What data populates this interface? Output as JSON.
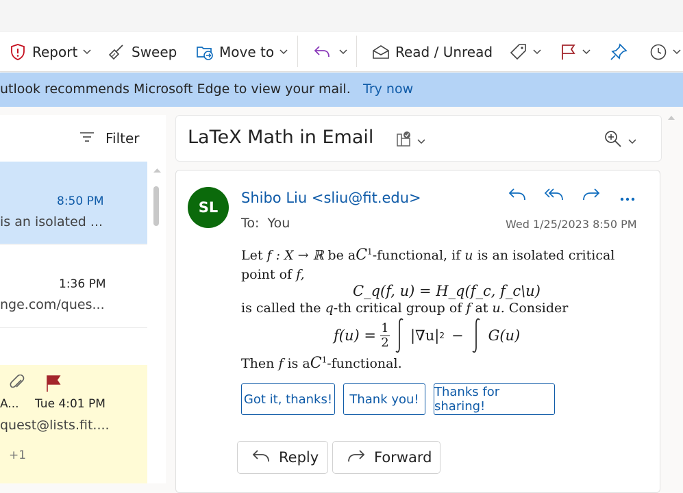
{
  "toolbar": {
    "report_label": "Report",
    "sweep_label": "Sweep",
    "move_label": "Move to",
    "read_label": "Read / Unread"
  },
  "banner": {
    "text": "utlook recommends Microsoft Edge to view your mail.",
    "link": "Try now"
  },
  "list": {
    "filter_label": "Filter",
    "items": [
      {
        "time": "8:50 PM",
        "preview": "is an isolated ..."
      },
      {
        "time": "1:36 PM",
        "preview": "nge.com/ques..."
      },
      {
        "sender": "A...",
        "time": "Tue 4:01 PM",
        "preview": "quest@lists.fit....",
        "extra": "+1"
      }
    ]
  },
  "reading": {
    "subject": "LaTeX Math in Email",
    "sender": "Shibo Liu <sliu@fit.edu>",
    "avatar_initials": "SL",
    "to_label": "To:",
    "to_value": "You",
    "date": "Wed 1/25/2023 8:50 PM",
    "body": {
      "l1_a": "Let",
      "l1_b": "f : X → ℝ",
      "l1_c": "be a",
      "l1_d": "C",
      "l1_e": "1",
      "l1_f": "-functional, if",
      "l1_g": "u",
      "l1_h": "is an isolated critical",
      "l2_a": "point of",
      "l2_b": "f,",
      "eq1": "C_q(f, u) = H_q(f_c, f_c\\u)",
      "l3_a": "is called the",
      "l3_b": "q",
      "l3_c": "-th critical group of",
      "l3_d": "f",
      "l3_e": "at",
      "l3_f": "u.",
      "l3_g": "Consider",
      "eq2_lhs": "f(u) =",
      "eq2_num": "1",
      "eq2_den": "2",
      "eq2_mid": "|∇u|",
      "eq2_pow": "2",
      "eq2_minus": "−",
      "eq2_rhs": "G(u)",
      "l4_a": "Then",
      "l4_b": "f",
      "l4_c": "is a",
      "l4_d": "C",
      "l4_e": "1",
      "l4_f": "-functional."
    },
    "quick_replies": [
      "Got it, thanks!",
      "Thank you!",
      "Thanks for sharing!"
    ],
    "reply_label": "Reply",
    "forward_label": "Forward"
  },
  "colors": {
    "accent": "#0f5ba8",
    "banner": "#b4d3f6",
    "selected_row": "#cfe4fa",
    "flagged_row": "#fffbd6",
    "avatar": "#0b6a0b",
    "flag": "#a4262c",
    "report_icon": "#c50f1f",
    "reply_icon": "#8a3ab9"
  }
}
